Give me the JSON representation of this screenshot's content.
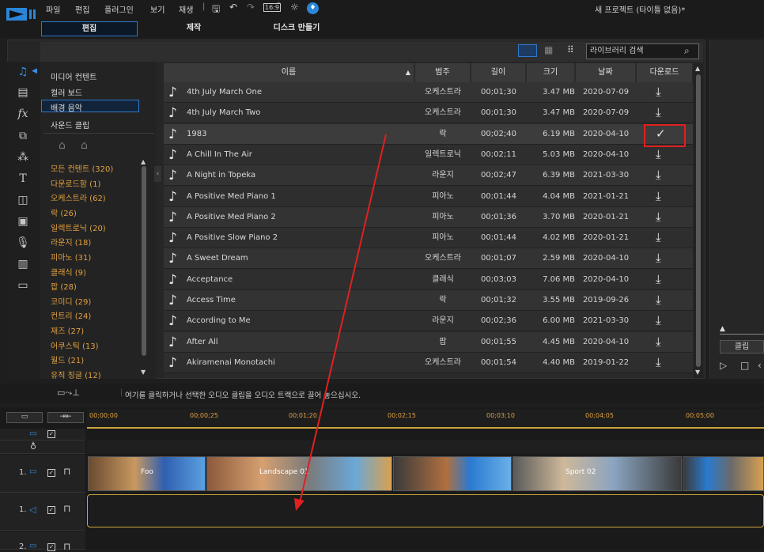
{
  "menu": {
    "items": [
      "파일",
      "편집",
      "플러그인",
      "보기",
      "재생"
    ],
    "title": "새 프로젝트 (타이틀 없음)*"
  },
  "tabs": [
    "편집",
    "제작",
    "디스크 만들기"
  ],
  "search": {
    "placeholder": "라이브러리 검색"
  },
  "sidebar": {
    "top_items": [
      "미디어 컨텐트",
      "컬러 보드",
      "배경 음악",
      "사운드 클립"
    ],
    "categories": [
      "모든 컨텐트 (320)",
      "다운로드함 (1)",
      "오케스트라 (62)",
      "락 (26)",
      "일렉트로닉 (20)",
      "라운지 (18)",
      "피아노 (31)",
      "클래식 (9)",
      "팝 (28)",
      "코미디 (29)",
      "컨트리 (24)",
      "재즈 (27)",
      "어쿠스틱 (13)",
      "월드 (21)",
      "유직 징글 (12)"
    ]
  },
  "table": {
    "headers": [
      "이름",
      "범주",
      "길이",
      "크기",
      "날짜",
      "다운로드"
    ],
    "rows": [
      [
        "4th July March One",
        "오케스트라",
        "00;01;30",
        "3.47 MB",
        "2020-07-09"
      ],
      [
        "4th July March Two",
        "오케스트라",
        "00;01;30",
        "3.47 MB",
        "2020-07-09"
      ],
      [
        "1983",
        "락",
        "00;02;40",
        "6.19 MB",
        "2020-04-10"
      ],
      [
        "A Chill In The Air",
        "일렉트로닉",
        "00;02;11",
        "5.03 MB",
        "2020-04-10"
      ],
      [
        "A Night in Topeka",
        "라운지",
        "00;02;47",
        "6.39 MB",
        "2021-03-30"
      ],
      [
        "A Positive Med Piano 1",
        "피아노",
        "00;01;44",
        "4.04 MB",
        "2021-01-21"
      ],
      [
        "A Positive Med Piano 2",
        "피아노",
        "00;01;36",
        "3.70 MB",
        "2020-01-21"
      ],
      [
        "A Positive Slow Piano 2",
        "피아노",
        "00;01;44",
        "4.02 MB",
        "2020-01-21"
      ],
      [
        "A Sweet Dream",
        "오케스트라",
        "00;01;07",
        "2.59 MB",
        "2020-04-10"
      ],
      [
        "Acceptance",
        "클래식",
        "00;03;03",
        "7.06 MB",
        "2020-04-10"
      ],
      [
        "Access Time",
        "락",
        "00;01;32",
        "3.55 MB",
        "2019-09-26"
      ],
      [
        "According to Me",
        "라운지",
        "00;02;36",
        "6.00 MB",
        "2021-03-30"
      ],
      [
        "After All",
        "팝",
        "00;01;55",
        "4.45 MB",
        "2020-04-10"
      ],
      [
        "Akiramenai Monotachi",
        "오케스트라",
        "00;01;54",
        "4.40 MB",
        "2019-01-22"
      ]
    ]
  },
  "right": {
    "clip_label": "클립"
  },
  "hint": "여기를 클릭하거나 선택한 오디오 클립을 오디오 트랙으로 끌어 놓으십시오.",
  "ruler": [
    "00;00;00",
    "00;00;25",
    "00;01;20",
    "00;02;15",
    "00;03;10",
    "00;04;05",
    "00;05;00"
  ],
  "tracks": {
    "video_label": "1.",
    "audio_label": "1.",
    "next_label": "2."
  },
  "clips": [
    "Foo",
    "Landscape 01",
    "Sport 02"
  ]
}
